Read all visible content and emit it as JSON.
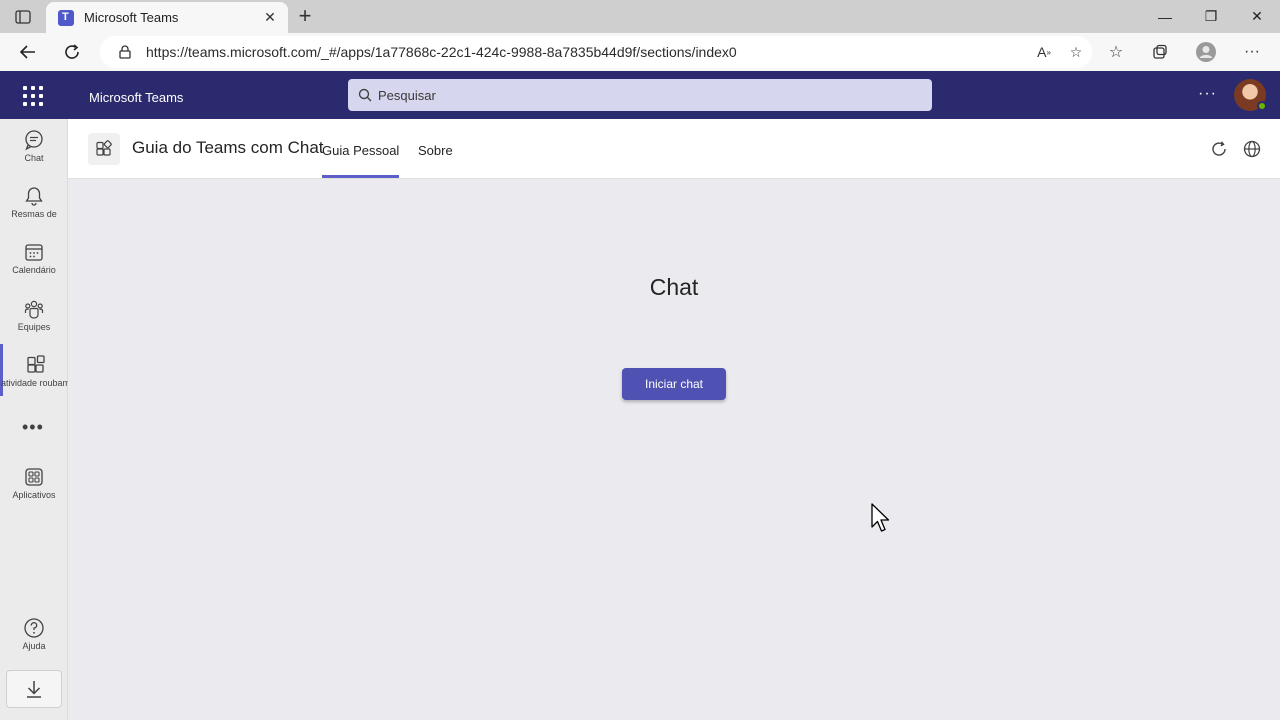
{
  "browser": {
    "tab_title": "Microsoft Teams",
    "tab_close": "✕",
    "new_tab": "+",
    "url": "https://teams.microsoft.com/_#/apps/1a77868c-22c1-424c-9988-8a7835b44d9f/sections/index0",
    "window_controls": {
      "minimize": "—",
      "restore": "❐",
      "close": "✕"
    }
  },
  "teams": {
    "app_name": "Microsoft Teams",
    "search_placeholder": "Pesquisar",
    "more_label": "···"
  },
  "rail": {
    "items": [
      {
        "label": "Chat",
        "icon": "chat-icon"
      },
      {
        "label": "Resmas de",
        "icon": "bell-icon"
      },
      {
        "label": "Calendário",
        "icon": "calendar-icon"
      },
      {
        "label": "Equipes",
        "icon": "teams-icon"
      },
      {
        "label": "atividade roubam",
        "icon": "apps-add-icon",
        "active": true
      },
      {
        "label": "Aplicativos",
        "icon": "apps-icon"
      },
      {
        "label": "Ajuda",
        "icon": "help-icon"
      }
    ],
    "more": "•••"
  },
  "app": {
    "title": "Guia do Teams com Chat",
    "tabs": [
      {
        "label": "Guia Pessoal",
        "active": true
      },
      {
        "label": "Sobre",
        "active": false
      }
    ]
  },
  "main": {
    "heading": "Chat",
    "start_button": "Iniciar chat"
  },
  "colors": {
    "teams_header": "#2b2a6e",
    "accent": "#5b5fc7",
    "button": "#4f52b2"
  }
}
